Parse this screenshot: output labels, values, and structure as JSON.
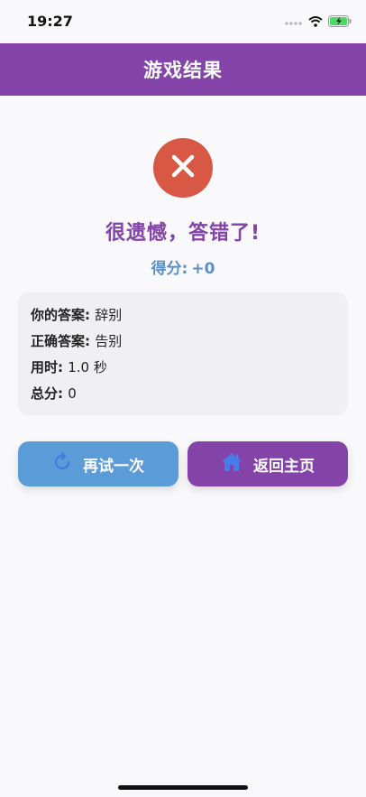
{
  "status": {
    "time": "19:27"
  },
  "header": {
    "title": "游戏结果"
  },
  "result": {
    "title": "很遗憾，答错了!",
    "score_label": "得分:",
    "score_value": "+0",
    "icon": "close-icon",
    "icon_color": "#d95745"
  },
  "details": [
    {
      "label": "你的答案",
      "value": "辞别"
    },
    {
      "label": "正确答案",
      "value": "告别"
    },
    {
      "label": "用时",
      "value": "1.0 秒"
    },
    {
      "label": "总分",
      "value": "0"
    }
  ],
  "buttons": {
    "retry": {
      "label": "再试一次",
      "icon": "refresh-icon",
      "color": "#5b9bd8"
    },
    "home": {
      "label": "返回主页",
      "icon": "home-icon",
      "color": "#8443a8"
    }
  },
  "colors": {
    "header": "#8443a8",
    "accent_blue": "#5b8fc6"
  }
}
